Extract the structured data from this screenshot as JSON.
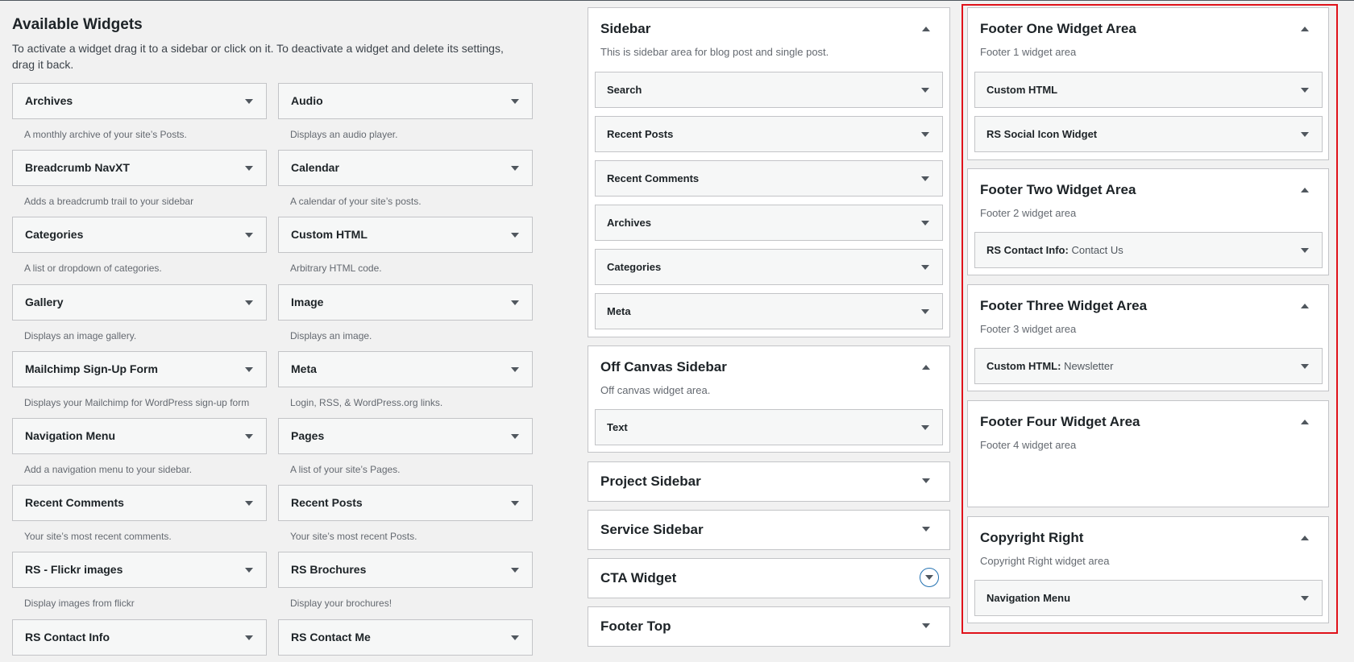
{
  "available": {
    "title": "Available Widgets",
    "intro": "To activate a widget drag it to a sidebar or click on it. To deactivate a widget and delete its settings, drag it back.",
    "widgets": [
      {
        "name": "Archives",
        "desc": "A monthly archive of your site’s Posts."
      },
      {
        "name": "Audio",
        "desc": "Displays an audio player."
      },
      {
        "name": "Breadcrumb NavXT",
        "desc": "Adds a breadcrumb trail to your sidebar"
      },
      {
        "name": "Calendar",
        "desc": "A calendar of your site’s posts."
      },
      {
        "name": "Categories",
        "desc": "A list or dropdown of categories."
      },
      {
        "name": "Custom HTML",
        "desc": "Arbitrary HTML code."
      },
      {
        "name": "Gallery",
        "desc": "Displays an image gallery."
      },
      {
        "name": "Image",
        "desc": "Displays an image."
      },
      {
        "name": "Mailchimp Sign-Up Form",
        "desc": "Displays your Mailchimp for WordPress sign-up form"
      },
      {
        "name": "Meta",
        "desc": "Login, RSS, & WordPress.org links."
      },
      {
        "name": "Navigation Menu",
        "desc": "Add a navigation menu to your sidebar."
      },
      {
        "name": "Pages",
        "desc": "A list of your site’s Pages."
      },
      {
        "name": "Recent Comments",
        "desc": "Your site’s most recent comments."
      },
      {
        "name": "Recent Posts",
        "desc": "Your site’s most recent Posts."
      },
      {
        "name": "RS - Flickr images",
        "desc": "Display images from flickr"
      },
      {
        "name": "RS Brochures",
        "desc": "Display your brochures!"
      },
      {
        "name": "RS Contact Info",
        "desc": ""
      },
      {
        "name": "RS Contact Me",
        "desc": ""
      }
    ]
  },
  "middle": {
    "sidebar": {
      "title": "Sidebar",
      "desc": "This is sidebar area for blog post and single post.",
      "widgets": [
        "Search",
        "Recent Posts",
        "Recent Comments",
        "Archives",
        "Categories",
        "Meta"
      ]
    },
    "off_canvas": {
      "title": "Off Canvas Sidebar",
      "desc": "Off canvas widget area.",
      "widgets": [
        "Text"
      ]
    },
    "project": {
      "title": "Project Sidebar"
    },
    "service": {
      "title": "Service Sidebar"
    },
    "cta": {
      "title": "CTA Widget"
    },
    "footer_top": {
      "title": "Footer Top"
    }
  },
  "right": {
    "footer_one": {
      "title": "Footer One Widget Area",
      "desc": "Footer 1 widget area",
      "widgets": [
        {
          "name": "Custom HTML",
          "sub": ""
        },
        {
          "name": "RS Social Icon Widget",
          "sub": ""
        }
      ]
    },
    "footer_two": {
      "title": "Footer Two Widget Area",
      "desc": "Footer 2 widget area",
      "widgets": [
        {
          "name": "RS Contact Info:",
          "sub": "Contact Us"
        }
      ]
    },
    "footer_three": {
      "title": "Footer Three Widget Area",
      "desc": "Footer 3 widget area",
      "widgets": [
        {
          "name": "Custom HTML:",
          "sub": "Newsletter"
        }
      ]
    },
    "footer_four": {
      "title": "Footer Four Widget Area",
      "desc": "Footer 4 widget area",
      "widgets": []
    },
    "copyright": {
      "title": "Copyright Right",
      "desc": "Copyright Right widget area",
      "widgets": [
        {
          "name": "Navigation Menu",
          "sub": ""
        }
      ]
    }
  },
  "colors": {
    "highlight": "#e0121a",
    "accent": "#2271b1"
  }
}
